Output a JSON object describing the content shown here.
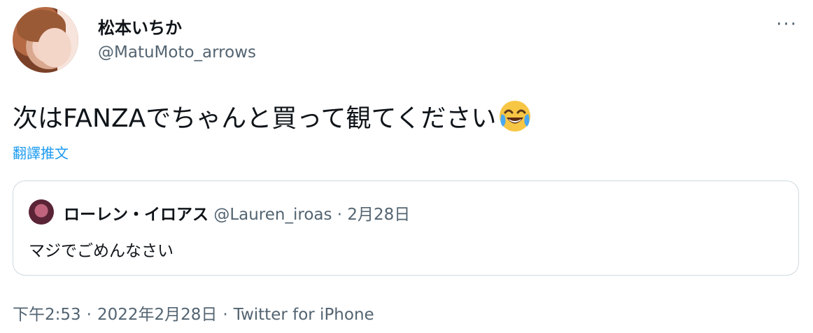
{
  "author": {
    "display_name": "松本いちか",
    "handle": "@MatuMoto_arrows"
  },
  "more_label": "···",
  "tweet": {
    "text": "次はFANZAでちゃんと買って観てください",
    "emoji": "face-with-tears-of-joy",
    "translate_label": "翻譯推文"
  },
  "quote": {
    "display_name": "ローレン・イロアス",
    "handle": "@Lauren_iroas",
    "separator": "·",
    "date": "2月28日",
    "text": "マジでごめんなさい"
  },
  "meta": {
    "time": "下午2:53",
    "separator": "·",
    "date": "2022年2月28日",
    "source": "Twitter for iPhone"
  },
  "colors": {
    "text_primary": "#0f1419",
    "text_secondary": "#536471",
    "link": "#1d9bf0",
    "border": "#cfd9de"
  }
}
